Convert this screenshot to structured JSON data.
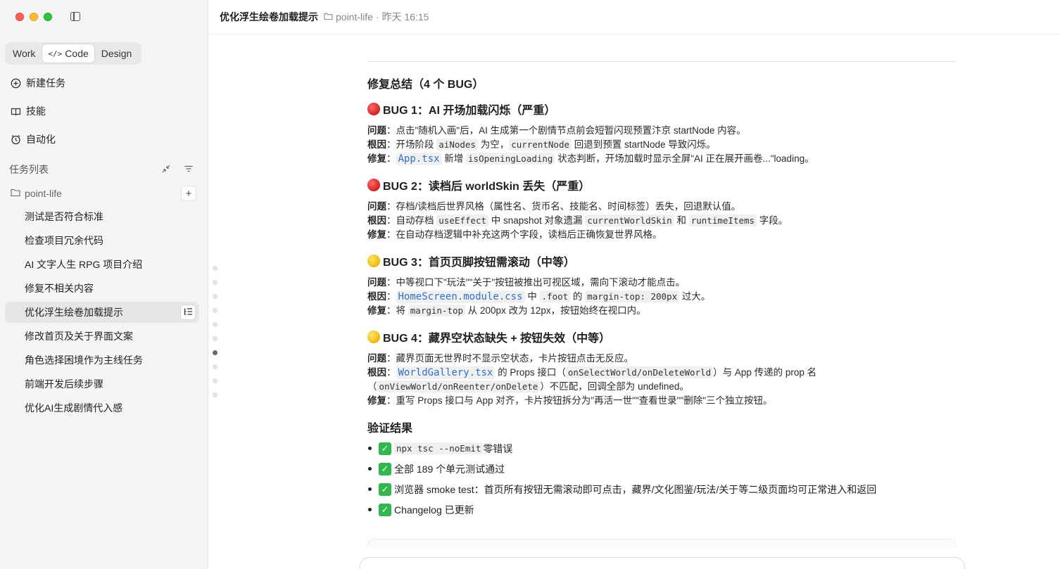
{
  "sidebar": {
    "mode_tabs": [
      {
        "label": "Work"
      },
      {
        "label": "Code"
      },
      {
        "label": "Design"
      }
    ],
    "nav": [
      {
        "label": "新建任务"
      },
      {
        "label": "技能"
      },
      {
        "label": "自动化"
      }
    ],
    "section_title": "任务列表",
    "project_name": "point-life",
    "tasks": [
      {
        "label": "测试是否符合标准"
      },
      {
        "label": "检查项目冗余代码"
      },
      {
        "label": "AI 文字人生 RPG 项目介绍"
      },
      {
        "label": "修复不相关内容"
      },
      {
        "label": "优化浮生绘卷加载提示"
      },
      {
        "label": "修改首页及关于界面文案"
      },
      {
        "label": "角色选择困境作为主线任务"
      },
      {
        "label": "前端开发后续步骤"
      },
      {
        "label": "优化AI生成剧情代入感"
      }
    ]
  },
  "header": {
    "title": "优化浮生绘卷加载提示",
    "project": "point-life",
    "time": "· 昨天 16:15"
  },
  "content": {
    "summary_title": "修复总结（4 个 BUG）",
    "bugs": [
      {
        "title": "BUG 1：AI 开场加载闪烁（严重）",
        "problem_label": "问题",
        "problem": "：点击\"随机入画\"后，AI 生成第一个剧情节点前会短暂闪现预置汴京 startNode 内容。",
        "cause_label": "根因",
        "cause_a": "：开场阶段 ",
        "cause_code1": "aiNodes",
        "cause_b": " 为空，",
        "cause_code2": "currentNode",
        "cause_c": " 回退到预置 startNode 导致闪烁。",
        "fix_label": "修复",
        "fix_a": "：",
        "fix_file": "App.tsx",
        "fix_b": " 新增 ",
        "fix_code": "isOpeningLoading",
        "fix_c": " 状态判断，开场加载时显示全屏\"AI 正在展开画卷...\"loading。"
      },
      {
        "title": "BUG 2：读档后 worldSkin 丢失（严重）",
        "problem_label": "问题",
        "problem": "：存档/读档后世界风格（属性名、货币名、技能名、时间标签）丢失，回退默认值。",
        "cause_label": "根因",
        "cause_a": "：自动存档 ",
        "cause_code1": "useEffect",
        "cause_b": " 中 snapshot 对象遗漏 ",
        "cause_code2": "currentWorldSkin",
        "cause_c": " 和 ",
        "cause_code3": "runtimeItems",
        "cause_d": " 字段。",
        "fix_label": "修复",
        "fix": "：在自动存档逻辑中补充这两个字段，读档后正确恢复世界风格。"
      },
      {
        "title": "BUG 3：首页页脚按钮需滚动（中等）",
        "problem_label": "问题",
        "problem": "：中等视口下\"玩法\"\"关于\"按钮被推出可视区域，需向下滚动才能点击。",
        "cause_label": "根因",
        "cause_a": "：",
        "cause_file": "HomeScreen.module.css",
        "cause_b": " 中 ",
        "cause_code1": ".foot",
        "cause_c": " 的 ",
        "cause_code2": "margin-top: 200px",
        "cause_d": " 过大。",
        "fix_label": "修复",
        "fix_a": "：将 ",
        "fix_code": "margin-top",
        "fix_b": " 从 200px 改为 12px，按钮始终在视口内。"
      },
      {
        "title": "BUG 4：藏界空状态缺失 + 按钮失效（中等）",
        "problem_label": "问题",
        "problem": "：藏界页面无世界时不显示空状态，卡片按钮点击无反应。",
        "cause_label": "根因",
        "cause_a": "：",
        "cause_file": "WorldGallery.tsx",
        "cause_b": " 的 Props 接口（",
        "cause_code1": "onSelectWorld",
        "cause_sep1": "/",
        "cause_code2": "onDeleteWorld",
        "cause_c": "）与 App 传递的 prop 名",
        "cause2_a": "（",
        "cause2_code1": "onViewWorld",
        "cause2_sep1": "/",
        "cause2_code2": "onReenter",
        "cause2_sep2": "/",
        "cause2_code3": "onDelete",
        "cause2_b": "）不匹配，回调全部为 undefined。",
        "fix_label": "修复",
        "fix": "：重写 Props 接口与 App 对齐，卡片按钮拆分为\"再活一世\"\"查看世录\"\"删除\"三个独立按钮。"
      }
    ],
    "verify_title": "验证结果",
    "verify": {
      "item1_code": "npx tsc --noEmit",
      "item1_text": " 零错误",
      "item2": "全部 189 个单元测试通过",
      "item3": "浏览器 smoke test：首页所有按钮无需滚动即可点击，藏界/文化图鉴/玩法/关于等二级页面均可正常进入和返回",
      "item4": "Changelog 已更新"
    }
  }
}
